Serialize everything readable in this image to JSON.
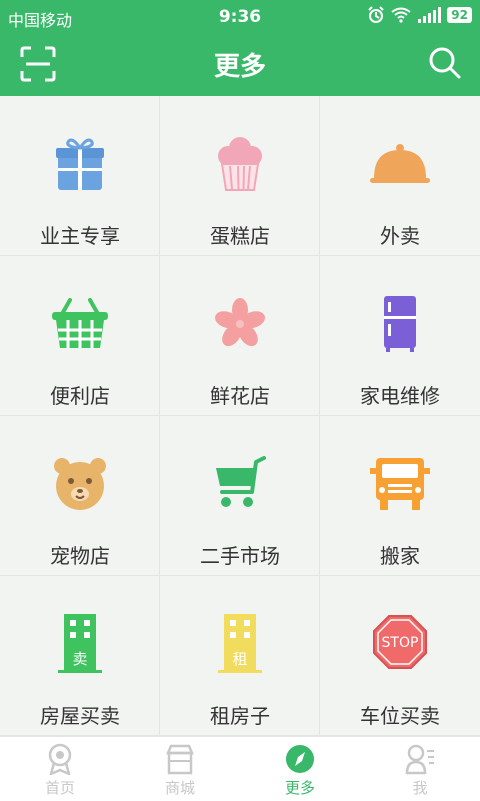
{
  "status_bar": {
    "carrier": "中国移动",
    "time": "9:36",
    "battery": "92"
  },
  "header": {
    "title": "更多",
    "scan_icon": "scan-icon",
    "search_icon": "search-icon"
  },
  "services": [
    {
      "label": "业主专享",
      "icon": "gift-icon",
      "color": "#6aa3e0"
    },
    {
      "label": "蛋糕店",
      "icon": "cupcake-icon",
      "color": "#f2a7b8"
    },
    {
      "label": "外卖",
      "icon": "food-cloche-icon",
      "color": "#f0a65a"
    },
    {
      "label": "便利店",
      "icon": "basket-icon",
      "color": "#3fc35f"
    },
    {
      "label": "鲜花店",
      "icon": "flower-icon",
      "color": "#f4a0a0"
    },
    {
      "label": "家电维修",
      "icon": "fridge-icon",
      "color": "#7b5fd6"
    },
    {
      "label": "宠物店",
      "icon": "bear-icon",
      "color": "#e8b46a"
    },
    {
      "label": "二手市场",
      "icon": "shopping-cart-icon",
      "color": "#39b86a"
    },
    {
      "label": "搬家",
      "icon": "truck-icon",
      "color": "#f7a034"
    },
    {
      "label": "房屋买卖",
      "icon": "building-sell-icon",
      "color": "#3fc35f"
    },
    {
      "label": "租房子",
      "icon": "building-rent-icon",
      "color": "#f2dc5d"
    },
    {
      "label": "车位买卖",
      "icon": "stop-sign-icon",
      "color": "#f06a6a"
    }
  ],
  "tabbar": [
    {
      "label": "首页",
      "icon": "home-badge-icon"
    },
    {
      "label": "商城",
      "icon": "shop-icon"
    },
    {
      "label": "更多",
      "icon": "compass-icon",
      "active": true
    },
    {
      "label": "我",
      "icon": "user-icon"
    }
  ],
  "colors": {
    "primary": "#39b86a",
    "inactive": "#c8c8c8"
  }
}
